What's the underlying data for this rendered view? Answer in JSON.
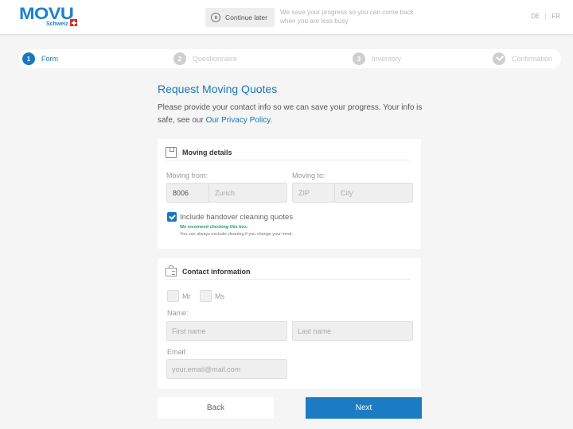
{
  "header": {
    "logo": {
      "word": "MOVU",
      "sub": "Schweiz"
    },
    "continue_later": {
      "label": "Continue later",
      "icon": "pause-icon"
    },
    "save_note": "We save your progress so you can come back when you are less busy",
    "languages": [
      "DE",
      "FR"
    ]
  },
  "stepper": {
    "steps": [
      {
        "num": "1",
        "label": "Form",
        "active": true
      },
      {
        "num": "2",
        "label": "Questionnaire",
        "active": false
      },
      {
        "num": "3",
        "label": "Inventory",
        "active": false
      },
      {
        "num": "",
        "label": "Confirmation",
        "active": false,
        "icon": "check-icon"
      }
    ]
  },
  "main": {
    "title": "Request Moving Quotes",
    "intro_text": "Please provide your contact info so we can save your progress. Your info is safe, see our ",
    "privacy_link": "Our Privacy Policy",
    "intro_end": "."
  },
  "moving_details": {
    "title": "Moving details",
    "icon": "box-icon",
    "from_label": "Moving from:",
    "from_zip": "8006",
    "from_city": "Zurich",
    "to_label": "Moving to:",
    "to_zip_placeholder": "ZIP",
    "to_city_placeholder": "City",
    "cleaning_checkbox": {
      "label": "Include handover cleaning quotes",
      "checked": true
    },
    "recommend": "We recomend checking this box.",
    "hint": "You can always exclude cleaning if you change your mind."
  },
  "contact_info": {
    "title": "Contact information",
    "icon": "id-badge-icon",
    "salutations": [
      "Mr",
      "Ms"
    ],
    "name_label": "Name:",
    "first_name_placeholder": "First name",
    "last_name_placeholder": "Last name",
    "email_label": "Email:",
    "email_placeholder": "your.email@mail.com"
  },
  "actions": {
    "back": "Back",
    "next": "Next"
  },
  "colors": {
    "brand": "#1b76bb",
    "primary_button": "#1b7cc3",
    "recommend": "#1aa36b",
    "logo_flag": "#e3262a"
  }
}
